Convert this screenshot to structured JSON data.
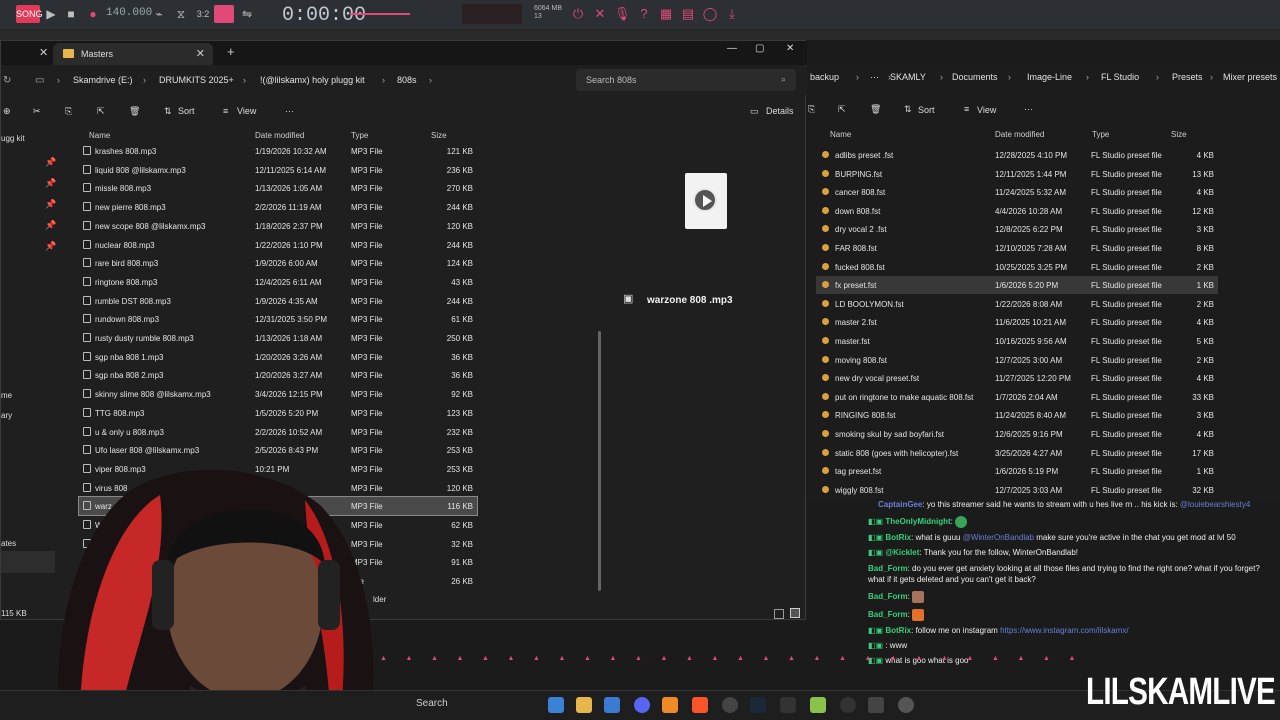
{
  "daw": {
    "tempo": "140.000",
    "time": "0:00:00",
    "cpu_line1": "6064 MB",
    "cpu_line2": "13"
  },
  "explorer": {
    "tab_title": "Masters",
    "breadcrumb": [
      "Skamdrive (E:)",
      "DRUMKITS 2025+",
      "!(@lilskamx) holy plugg kit",
      "808s"
    ],
    "search_placeholder": "Search 808s",
    "toolbar": {
      "sort": "Sort",
      "view": "View",
      "more": "···",
      "details": "Details"
    },
    "columns": [
      "Name",
      "Date modified",
      "Type",
      "Size"
    ],
    "sidebar_labels": [
      "ugg kit",
      "me",
      "ary",
      "ates"
    ],
    "status_size": "115 KB",
    "status_folder": "lder",
    "files": [
      {
        "name": "krashes 808.mp3",
        "date": "1/19/2026 10:32 AM",
        "type": "MP3 File",
        "size": "121 KB"
      },
      {
        "name": "liquid 808 @lilskamx.mp3",
        "date": "12/11/2025 6:14 AM",
        "type": "MP3 File",
        "size": "236 KB"
      },
      {
        "name": "missle 808.mp3",
        "date": "1/13/2026 1:05 AM",
        "type": "MP3 File",
        "size": "270 KB"
      },
      {
        "name": "new pierre 808.mp3",
        "date": "2/2/2026 11:19 AM",
        "type": "MP3 File",
        "size": "244 KB"
      },
      {
        "name": "new scope 808 @lilskamx.mp3",
        "date": "1/18/2026 2:37 PM",
        "type": "MP3 File",
        "size": "120 KB"
      },
      {
        "name": "nuclear 808.mp3",
        "date": "1/22/2026 1:10 PM",
        "type": "MP3 File",
        "size": "244 KB"
      },
      {
        "name": "rare bird 808.mp3",
        "date": "1/9/2026 6:00 AM",
        "type": "MP3 File",
        "size": "124 KB"
      },
      {
        "name": "ringtone 808.mp3",
        "date": "12/4/2025 6:11 AM",
        "type": "MP3 File",
        "size": "43 KB"
      },
      {
        "name": "rumble DST 808.mp3",
        "date": "1/9/2026 4:35 AM",
        "type": "MP3 File",
        "size": "244 KB"
      },
      {
        "name": "rundown 808.mp3",
        "date": "12/31/2025 3:50 PM",
        "type": "MP3 File",
        "size": "61 KB"
      },
      {
        "name": "rusty dusty rumble 808.mp3",
        "date": "1/13/2026 1:18 AM",
        "type": "MP3 File",
        "size": "250 KB"
      },
      {
        "name": "sgp nba 808 1.mp3",
        "date": "1/20/2026 3:26 AM",
        "type": "MP3 File",
        "size": "36 KB"
      },
      {
        "name": "sgp nba 808 2.mp3",
        "date": "1/20/2026 3:27 AM",
        "type": "MP3 File",
        "size": "36 KB"
      },
      {
        "name": "skinny slime 808 @lilskamx.mp3",
        "date": "3/4/2026 12:15 PM",
        "type": "MP3 File",
        "size": "92 KB"
      },
      {
        "name": "TTG 808.mp3",
        "date": "1/5/2026 5:20 PM",
        "type": "MP3 File",
        "size": "123 KB"
      },
      {
        "name": "u & only u 808.mp3",
        "date": "2/2/2026 10:52 AM",
        "type": "MP3 File",
        "size": "232 KB"
      },
      {
        "name": "Ufo laser 808 @lilskamx.mp3",
        "date": "2/5/2026 8:43 PM",
        "type": "MP3 File",
        "size": "253 KB"
      },
      {
        "name": "viper 808.mp3",
        "date": "10:21 PM",
        "type": "MP3 File",
        "size": "253 KB"
      },
      {
        "name": "virus 808",
        "date": "",
        "type": "MP3 File",
        "size": "120 KB"
      },
      {
        "name": "warz",
        "date": "",
        "type": "MP3 File",
        "size": "116 KB"
      },
      {
        "name": "W",
        "date": "",
        "type": "MP3 File",
        "size": "62 KB"
      },
      {
        "name": "W",
        "date": "",
        "type": "MP3 File",
        "size": "32 KB"
      },
      {
        "name": "",
        "date": "",
        "type": "MP3 File",
        "size": "91 KB"
      },
      {
        "name": "",
        "date": "",
        "type": "File",
        "size": "26 KB"
      }
    ],
    "preview_name": "warzone 808 .mp3"
  },
  "presets": {
    "breadcrumb": [
      "backup",
      "···",
      "SKAMLY",
      "Documents",
      "Image-Line",
      "FL Studio",
      "Presets",
      "Mixer presets"
    ],
    "toolbar": {
      "sort": "Sort",
      "view": "View",
      "more": "···"
    },
    "columns": [
      "Name",
      "Date modified",
      "Type",
      "Size"
    ],
    "files": [
      {
        "name": "adlibs preset .fst",
        "date": "12/28/2025 4:10 PM",
        "type": "FL Studio preset file",
        "size": "4 KB"
      },
      {
        "name": "BURPING.fst",
        "date": "12/11/2025 1:44 PM",
        "type": "FL Studio preset file",
        "size": "13 KB"
      },
      {
        "name": "cancer 808.fst",
        "date": "11/24/2025 5:32 AM",
        "type": "FL Studio preset file",
        "size": "4 KB"
      },
      {
        "name": "down 808.fst",
        "date": "4/4/2026 10:28 AM",
        "type": "FL Studio preset file",
        "size": "12 KB"
      },
      {
        "name": "dry vocal 2 .fst",
        "date": "12/8/2025 6:22 PM",
        "type": "FL Studio preset file",
        "size": "3 KB"
      },
      {
        "name": "FAR 808.fst",
        "date": "12/10/2025 7:28 AM",
        "type": "FL Studio preset file",
        "size": "8 KB"
      },
      {
        "name": "fucked 808.fst",
        "date": "10/25/2025 3:25 PM",
        "type": "FL Studio preset file",
        "size": "2 KB"
      },
      {
        "name": "fx preset.fst",
        "date": "1/6/2026 5:20 PM",
        "type": "FL Studio preset file",
        "size": "1 KB"
      },
      {
        "name": "LD BOOLYMON.fst",
        "date": "1/22/2026 8:08 AM",
        "type": "FL Studio preset file",
        "size": "2 KB"
      },
      {
        "name": "master 2.fst",
        "date": "11/6/2025 10:21 AM",
        "type": "FL Studio preset file",
        "size": "4 KB"
      },
      {
        "name": "master.fst",
        "date": "10/16/2025 9:56 AM",
        "type": "FL Studio preset file",
        "size": "5 KB"
      },
      {
        "name": "moving 808.fst",
        "date": "12/7/2025 3:00 AM",
        "type": "FL Studio preset file",
        "size": "2 KB"
      },
      {
        "name": "new dry vocal preset.fst",
        "date": "11/27/2025 12:20 PM",
        "type": "FL Studio preset file",
        "size": "4 KB"
      },
      {
        "name": "put on ringtone to make aquatic 808.fst",
        "date": "1/7/2026 2:04 AM",
        "type": "FL Studio preset file",
        "size": "33 KB"
      },
      {
        "name": "RINGING 808.fst",
        "date": "11/24/2025 8:40 AM",
        "type": "FL Studio preset file",
        "size": "3 KB"
      },
      {
        "name": "smoking skul by sad boyfari.fst",
        "date": "12/6/2025 9:16 PM",
        "type": "FL Studio preset file",
        "size": "4 KB"
      },
      {
        "name": "static 808 (goes with helicopter).fst",
        "date": "3/25/2026 4:27 AM",
        "type": "FL Studio preset file",
        "size": "17 KB"
      },
      {
        "name": "tag preset.fst",
        "date": "1/6/2026 5:19 PM",
        "type": "FL Studio preset file",
        "size": "1 KB"
      },
      {
        "name": "wiggly 808.fst",
        "date": "12/7/2025 3:03 AM",
        "type": "FL Studio preset file",
        "size": "32 KB"
      }
    ]
  },
  "chat": [
    {
      "user": "CaptainGee",
      "color": "#6a7fd9",
      "text": ": yo this streamer said he wants to stream with u hes live rn .. his kick is:",
      "link": "@louiebearshiesty4"
    },
    {
      "user": "TheOnlyMidnight",
      "color": "#35d07a",
      "text": ":",
      "link": ""
    },
    {
      "user": "BotRix",
      "color": "#35d07a",
      "text": ": what is guuu",
      "link": "@WinterOnBandlab",
      "tail": "make sure you're active in the chat you get mod at lvl 50"
    },
    {
      "user": "@Kicklet",
      "color": "#35d07a",
      "text": ": Thank you for the follow, WinterOnBandlab!",
      "link": ""
    },
    {
      "user": "Bad_Form",
      "color": "#35d07a",
      "text": ": do you ever get anxiety looking at all those files and trying to find the right one? what if you forget? what if it gets deleted and you can't get it back?",
      "link": ""
    },
    {
      "user": "Bad_Form",
      "color": "#35d07a",
      "text": ":",
      "link": ""
    },
    {
      "user": "Bad_Form",
      "color": "#35d07a",
      "text": ":",
      "link": ""
    },
    {
      "user": "BotRix",
      "color": "#35d07a",
      "text": ": follow me on instagram",
      "link": "https://www.instagram.com/lilskamx/"
    },
    {
      "user": "",
      "color": "#e14a78",
      "text": ": www",
      "link": ""
    },
    {
      "user": "",
      "color": "#e14a78",
      "text": "what is goo what is goo",
      "link": ""
    }
  ],
  "taskbar": {
    "search": "Search"
  },
  "brand": "LILSKAMLIVE"
}
